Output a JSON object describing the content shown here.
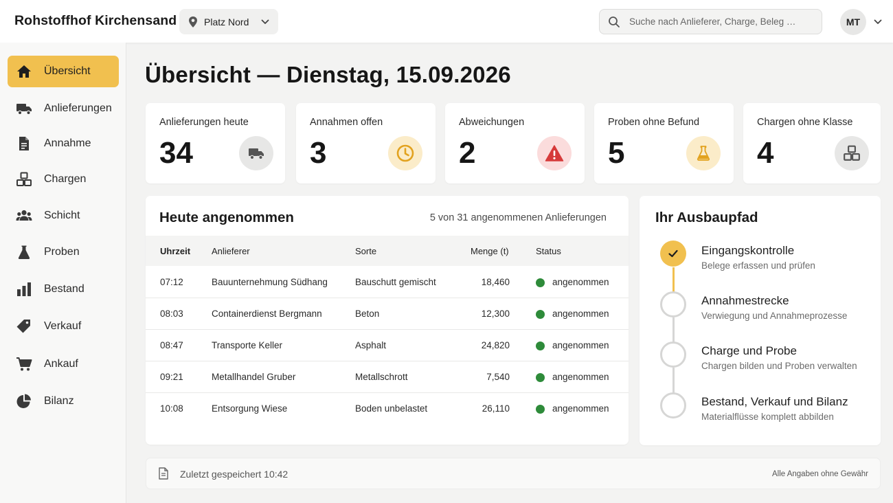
{
  "app": {
    "title": "Rohstoffhof Kirchensand"
  },
  "header": {
    "site": "Platz Nord",
    "search_placeholder": "Suche nach Anlieferer, Charge, Beleg …",
    "user_initials": "MT"
  },
  "sidebar": {
    "items": [
      {
        "label": "Übersicht",
        "icon": "home-icon",
        "active": true
      },
      {
        "label": "Anlieferungen",
        "icon": "truck-icon"
      },
      {
        "label": "Annahme",
        "icon": "document-icon"
      },
      {
        "label": "Chargen",
        "icon": "boxes-icon"
      },
      {
        "label": "Schicht",
        "icon": "people-icon"
      },
      {
        "label": "Proben",
        "icon": "flask-icon"
      },
      {
        "label": "Bestand",
        "icon": "bar-chart-icon"
      },
      {
        "label": "Verkauf",
        "icon": "tag-icon"
      },
      {
        "label": "Ankauf",
        "icon": "cart-icon"
      },
      {
        "label": "Bilanz",
        "icon": "pie-chart-icon"
      }
    ]
  },
  "page": {
    "title": "Übersicht — Dienstag, 15.09.2026"
  },
  "kpis": [
    {
      "label": "Anlieferungen heute",
      "value": "34",
      "icon": "truck-icon",
      "color": "#e7e7e6"
    },
    {
      "label": "Annahmen offen",
      "value": "3",
      "icon": "clock-icon",
      "color": "#fbecc9"
    },
    {
      "label": "Abweichungen",
      "value": "2",
      "icon": "warning-icon",
      "color": "#fbdcdc"
    },
    {
      "label": "Proben ohne Befund",
      "value": "5",
      "icon": "flask-icon",
      "color": "#fbecc9"
    },
    {
      "label": "Chargen ohne Klasse",
      "value": "4",
      "icon": "boxes-icon",
      "color": "#e7e7e6"
    }
  ],
  "table": {
    "title": "Heute angenommen",
    "meta": "5 von 31 angenommenen Anlieferungen",
    "columns": [
      "Uhrzeit",
      "Anlieferer",
      "Sorte",
      "Menge (t)",
      "Status"
    ],
    "rows": [
      {
        "time": "07:12",
        "supplier": "Bauunternehmung Südhang",
        "sort": "Bauschutt gemischt",
        "qty": "18,460",
        "status": "angenommen"
      },
      {
        "time": "08:03",
        "supplier": "Containerdienst Bergmann",
        "sort": "Beton",
        "qty": "12,300",
        "status": "angenommen"
      },
      {
        "time": "08:47",
        "supplier": "Transporte Keller",
        "sort": "Asphalt",
        "qty": "24,820",
        "status": "angenommen"
      },
      {
        "time": "09:21",
        "supplier": "Metallhandel Gruber",
        "sort": "Metallschrott",
        "qty": "7,540",
        "status": "angenommen"
      },
      {
        "time": "10:08",
        "supplier": "Entsorgung Wiese",
        "sort": "Boden unbelastet",
        "qty": "26,110",
        "status": "angenommen"
      }
    ],
    "status_color": "#2e8b3a"
  },
  "path": {
    "title": "Ihr Ausbaupfad",
    "steps": [
      {
        "title": "Eingangskontrolle",
        "sub": "Belege erfassen und prüfen",
        "done": true
      },
      {
        "title": "Annahmestrecke",
        "sub": "Verwiegung und Annahmeprozesse",
        "done": false
      },
      {
        "title": "Charge und Probe",
        "sub": "Chargen bilden und Proben verwalten",
        "done": false
      },
      {
        "title": "Bestand, Verkauf und Bilanz",
        "sub": "Materialflüsse komplett abbilden",
        "done": false
      }
    ],
    "accent": "#f1c04f"
  },
  "footer": {
    "saved": "Zuletzt gespeichert 10:42",
    "disclaimer": "Alle Angaben ohne Gewähr"
  }
}
